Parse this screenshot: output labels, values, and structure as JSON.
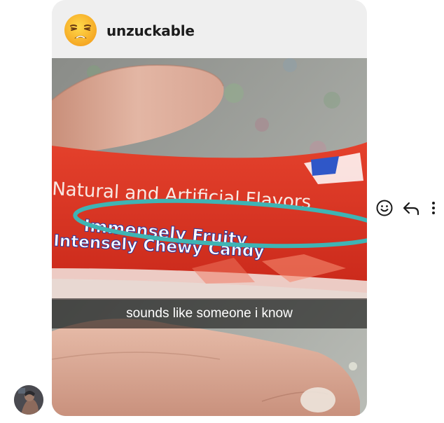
{
  "message": {
    "sender": {
      "username": "unzuckable",
      "avatar_icon": "weary-face-emoji-icon"
    },
    "photo": {
      "package_text_top": "Natural and Artificial Flavors",
      "package_text_highlight": "Immensely Fruity",
      "package_text_bottom": "Intensely Chewy Candy",
      "caption": "sounds like someone i know"
    }
  },
  "actions": {
    "react_icon": "smiley-face-icon",
    "reply_icon": "reply-arrow-icon",
    "more_icon": "more-vertical-icon"
  },
  "colors": {
    "header_bg": "#efefef",
    "highlight_circle": "#3fb4b4",
    "wrapper_red": "#d8301f"
  }
}
